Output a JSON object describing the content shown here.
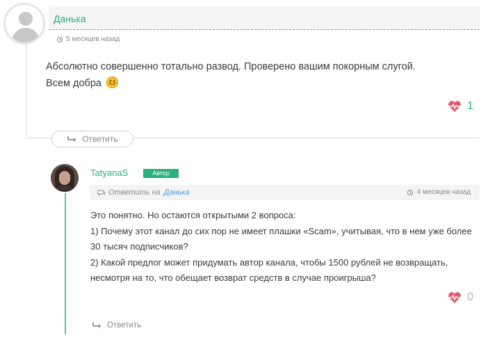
{
  "comment1": {
    "author": "Данька",
    "time": "5 месяцев назад",
    "text_line1": "Абсолютно совершенно тотально развод. Проверено вашим покорным слугой.",
    "text_line2": "Всем добра",
    "emoji": "smile-emoji",
    "likes": "1",
    "reply_label": "Ответить"
  },
  "comment2": {
    "author": "TatyanaS",
    "badge": "Автор",
    "reply_prefix": "Ответить на",
    "reply_to_name": "Данька",
    "time": "4 месяцев назад",
    "text": [
      "Это понятно. Но остаются открытыми 2 вопроса:",
      "1) Почему этот канал до сих пор не имеет плашки «Scam», учитывая, что в нем уже более",
      "30 тысяч подписчиков?",
      "2) Какой предлог может придумать автор канала, чтобы 1500 рублей не возвращать,",
      "несмотря на то, что обещает возврат средств в случае проигрыша?"
    ],
    "likes": "0",
    "reply_label": "Ответить"
  },
  "colors": {
    "accent": "#2eaa7c",
    "like_heart": "#e05a6b",
    "link": "#4a9bd6"
  }
}
